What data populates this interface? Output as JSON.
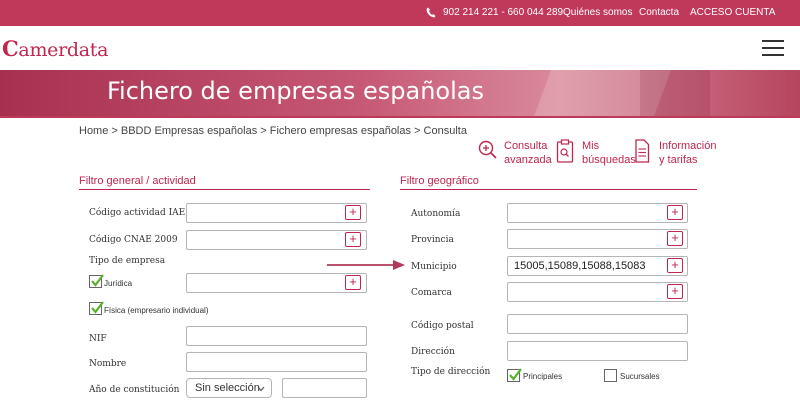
{
  "topbar": {
    "phone": "902 214 221 - 660 044 289",
    "links": [
      "Quiénes somos",
      "Contacta",
      "ACCESO CUENTA"
    ]
  },
  "header": {
    "logo_mark": "C",
    "logo_text": "amerdata"
  },
  "hero": {
    "title": "Fichero de empresas españolas"
  },
  "breadcrumb": "Home > BBDD Empresas españolas > Fichero empresas españolas > Consulta",
  "actions": [
    {
      "line1": "Consulta",
      "line2": "avanzada",
      "icon": "search-plus-icon"
    },
    {
      "line1": "Mis",
      "line2": "búsquedas",
      "icon": "clipboard-search-icon"
    },
    {
      "line1": "Información",
      "line2": "y tarifas",
      "icon": "document-icon"
    }
  ],
  "general": {
    "title": "Filtro general / actividad",
    "iae_label": "Código actividad IAE",
    "cnae_label": "Código CNAE 2009",
    "tipo_label": "Tipo de empresa",
    "juridica_label": "Jurídica",
    "juridica_checked": true,
    "fisica_label": "Física (empresario individual)",
    "fisica_checked": true,
    "nif_label": "NIF",
    "nombre_label": "Nombre",
    "anio_label": "Año de constitución",
    "anio_select": "Sin selección",
    "plus": "+"
  },
  "geo": {
    "title": "Filtro geográfico",
    "autonomia_label": "Autonomía",
    "provincia_label": "Provincia",
    "municipio_label": "Municipio",
    "municipio_value": "15005,15089,15088,15083",
    "comarca_label": "Comarca",
    "cp_label": "Código postal",
    "direccion_label": "Dirección",
    "tipo_dir_label": "Tipo de dirección",
    "principales_label": "Principales",
    "principales_checked": true,
    "sucursales_label": "Sucursales",
    "sucursales_checked": false
  },
  "colors": {
    "accent": "#c0264e",
    "topbar": "#c0395a",
    "check": "#5bb02c"
  }
}
